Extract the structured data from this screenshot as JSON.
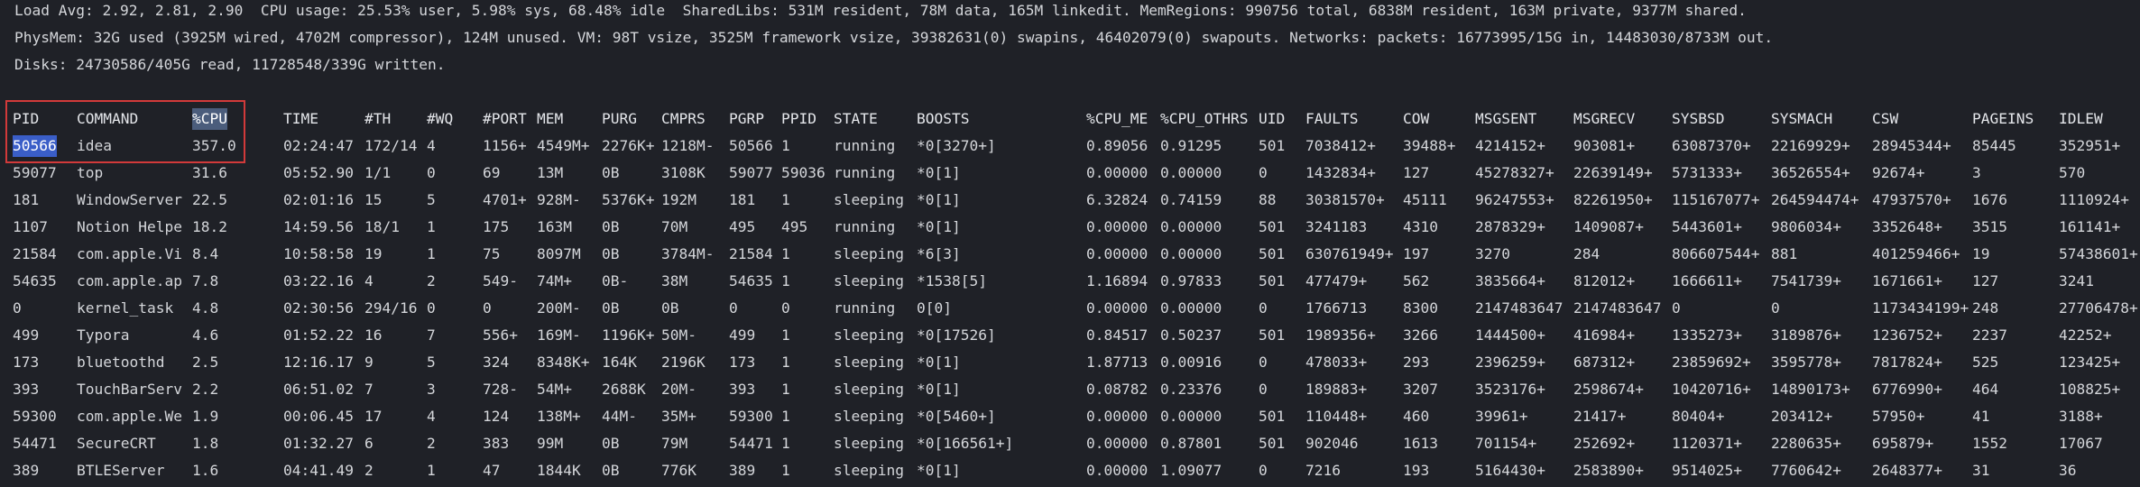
{
  "summary": {
    "line1": "Load Avg: 2.92, 2.81, 2.90  CPU usage: 25.53% user, 5.98% sys, 68.48% idle  SharedLibs: 531M resident, 78M data, 165M linkedit. MemRegions: 990756 total, 6838M resident, 163M private, 9377M shared.",
    "line2": "PhysMem: 32G used (3925M wired, 4702M compressor), 124M unused. VM: 98T vsize, 3525M framework vsize, 39382631(0) swapins, 46402079(0) swapouts. Networks: packets: 16773995/15G in, 14483030/8733M out.",
    "line3": "Disks: 24730586/405G read, 11728548/339G written."
  },
  "columns": [
    "PID",
    "COMMAND",
    "%CPU",
    "TIME",
    "#TH",
    "#WQ",
    "#PORT",
    "MEM",
    "PURG",
    "CMPRS",
    "PGRP",
    "PPID",
    "STATE",
    "BOOSTS",
    "%CPU_ME",
    "%CPU_OTHRS",
    "UID",
    "FAULTS",
    "COW",
    "MSGSENT",
    "MSGRECV",
    "SYSBSD",
    "SYSMACH",
    "CSW",
    "PAGEINS",
    "IDLEW"
  ],
  "rows": [
    [
      "50566",
      "idea",
      "357.0",
      "02:24:47",
      "172/14",
      "4",
      "1156+",
      "4549M+",
      "2276K+",
      "1218M-",
      "50566",
      "1",
      "running",
      "*0[3270+]",
      "0.89056",
      "0.91295",
      "501",
      "7038412+",
      "39488+",
      "4214152+",
      "903081+",
      "63087370+",
      "22169929+",
      "28945344+",
      "85445",
      "352951+"
    ],
    [
      "59077",
      "top",
      "31.6",
      "05:52.90",
      "1/1",
      "0",
      "69",
      "13M",
      "0B",
      "3108K",
      "59077",
      "59036",
      "running",
      "*0[1]",
      "0.00000",
      "0.00000",
      "0",
      "1432834+",
      "127",
      "45278327+",
      "22639149+",
      "5731333+",
      "36526554+",
      "92674+",
      "3",
      "570"
    ],
    [
      "181",
      "WindowServer",
      "22.5",
      "02:01:16",
      "15",
      "5",
      "4701+",
      "928M-",
      "5376K+",
      "192M",
      "181",
      "1",
      "sleeping",
      "*0[1]",
      "6.32824",
      "0.74159",
      "88",
      "30381570+",
      "45111",
      "96247553+",
      "82261950+",
      "115167077+",
      "264594474+",
      "47937570+",
      "1676",
      "1110924+"
    ],
    [
      "1107",
      "Notion Helpe",
      "18.2",
      "14:59.56",
      "18/1",
      "1",
      "175",
      "163M",
      "0B",
      "70M",
      "495",
      "495",
      "running",
      "*0[1]",
      "0.00000",
      "0.00000",
      "501",
      "3241183",
      "4310",
      "2878329+",
      "1409087+",
      "5443601+",
      "9806034+",
      "3352648+",
      "3515",
      "161141+"
    ],
    [
      "21584",
      "com.apple.Vi",
      "8.4",
      "10:58:58",
      "19",
      "1",
      "75",
      "8097M",
      "0B",
      "3784M-",
      "21584",
      "1",
      "sleeping",
      "*6[3]",
      "0.00000",
      "0.00000",
      "501",
      "630761949+",
      "197",
      "3270",
      "284",
      "806607544+",
      "881",
      "401259466+",
      "19",
      "57438601+"
    ],
    [
      "54635",
      "com.apple.ap",
      "7.8",
      "03:22.16",
      "4",
      "2",
      "549-",
      "74M+",
      "0B-",
      "38M",
      "54635",
      "1",
      "sleeping",
      "*1538[5]",
      "1.16894",
      "0.97833",
      "501",
      "477479+",
      "562",
      "3835664+",
      "812012+",
      "1666611+",
      "7541739+",
      "1671661+",
      "127",
      "3241"
    ],
    [
      "0",
      "kernel_task",
      "4.8",
      "02:30:56",
      "294/16",
      "0",
      "0",
      "200M-",
      "0B",
      "0B",
      "0",
      "0",
      "running",
      "0[0]",
      "0.00000",
      "0.00000",
      "0",
      "1766713",
      "8300",
      "2147483647",
      "2147483647",
      "0",
      "0",
      "1173434199+",
      "248",
      "27706478+"
    ],
    [
      "499",
      "Typora",
      "4.6",
      "01:52.22",
      "16",
      "7",
      "556+",
      "169M-",
      "1196K+",
      "50M-",
      "499",
      "1",
      "sleeping",
      "*0[17526]",
      "0.84517",
      "0.50237",
      "501",
      "1989356+",
      "3266",
      "1444500+",
      "416984+",
      "1335273+",
      "3189876+",
      "1236752+",
      "2237",
      "42252+"
    ],
    [
      "173",
      "bluetoothd",
      "2.5",
      "12:16.17",
      "9",
      "5",
      "324",
      "8348K+",
      "164K",
      "2196K",
      "173",
      "1",
      "sleeping",
      "*0[1]",
      "1.87713",
      "0.00916",
      "0",
      "478033+",
      "293",
      "2396259+",
      "687312+",
      "23859692+",
      "3595778+",
      "7817824+",
      "525",
      "123425+"
    ],
    [
      "393",
      "TouchBarServ",
      "2.2",
      "06:51.02",
      "7",
      "3",
      "728-",
      "54M+",
      "2688K",
      "20M-",
      "393",
      "1",
      "sleeping",
      "*0[1]",
      "0.08782",
      "0.23376",
      "0",
      "189883+",
      "3207",
      "3523176+",
      "2598674+",
      "10420716+",
      "14890173+",
      "6776990+",
      "464",
      "108825+"
    ],
    [
      "59300",
      "com.apple.We",
      "1.9",
      "00:06.45",
      "17",
      "4",
      "124",
      "138M+",
      "44M-",
      "35M+",
      "59300",
      "1",
      "sleeping",
      "*0[5460+]",
      "0.00000",
      "0.00000",
      "501",
      "110448+",
      "460",
      "39961+",
      "21417+",
      "80404+",
      "203412+",
      "57950+",
      "41",
      "3188+"
    ],
    [
      "54471",
      "SecureCRT",
      "1.8",
      "01:32.27",
      "6",
      "2",
      "383",
      "99M",
      "0B",
      "79M",
      "54471",
      "1",
      "sleeping",
      "*0[166561+]",
      "0.00000",
      "0.87801",
      "501",
      "902046",
      "1613",
      "701154+",
      "252692+",
      "1120371+",
      "2280635+",
      "695879+",
      "1552",
      "17067"
    ],
    [
      "389",
      "BTLEServer",
      "1.6",
      "04:41.49",
      "2",
      "1",
      "47",
      "1844K",
      "0B",
      "776K",
      "389",
      "1",
      "sleeping",
      "*0[1]",
      "0.00000",
      "1.09077",
      "0",
      "7216",
      "193",
      "5164430+",
      "2583890+",
      "9514025+",
      "7760642+",
      "2648377+",
      "31",
      "36"
    ]
  ],
  "colors": {
    "background": "#1f2127",
    "text": "#d4d6da",
    "highlight_box": "#d23a3a",
    "selection": "#3a5ec8"
  }
}
